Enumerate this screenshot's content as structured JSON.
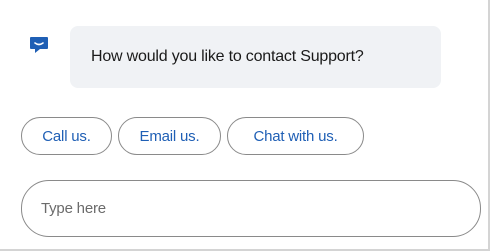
{
  "bot": {
    "avatar_icon": "chat-bubble-icon",
    "message": "How would you like to contact Support?"
  },
  "options": [
    {
      "label": "Call us."
    },
    {
      "label": "Email us."
    },
    {
      "label": "Chat with us."
    }
  ],
  "composer": {
    "placeholder": "Type here",
    "value": ""
  },
  "colors": {
    "accent": "#1f5fb5",
    "bubble_bg": "#f0f2f5",
    "border": "#8a8a8a"
  }
}
